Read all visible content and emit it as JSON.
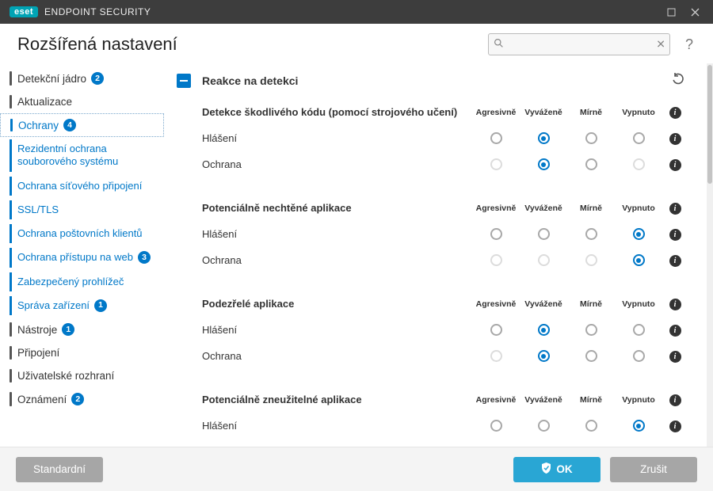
{
  "app": {
    "brand": "eset",
    "product": "ENDPOINT SECURITY",
    "page_title": "Rozšířená nastavení",
    "search_placeholder": ""
  },
  "sidebar": [
    {
      "label": "Detekční jádro",
      "level": 0,
      "badge": "2",
      "blue": false
    },
    {
      "label": "Aktualizace",
      "level": 0,
      "badge": null,
      "blue": false
    },
    {
      "label": "Ochrany",
      "level": 0,
      "badge": "4",
      "blue": true,
      "selected": true
    },
    {
      "label": "Rezidentní ochrana souborového systému",
      "level": 1
    },
    {
      "label": "Ochrana síťového připojení",
      "level": 1
    },
    {
      "label": "SSL/TLS",
      "level": 1
    },
    {
      "label": "Ochrana poštovních klientů",
      "level": 1
    },
    {
      "label": "Ochrana přístupu na web",
      "level": 1,
      "badge": "3"
    },
    {
      "label": "Zabezpečený prohlížeč",
      "level": 1
    },
    {
      "label": "Správa zařízení",
      "level": 1,
      "badge": "1"
    },
    {
      "label": "Nástroje",
      "level": 0,
      "badge": "1",
      "blue": false
    },
    {
      "label": "Připojení",
      "level": 0,
      "badge": null,
      "blue": false
    },
    {
      "label": "Uživatelské rozhraní",
      "level": 0,
      "badge": null,
      "blue": false
    },
    {
      "label": "Oznámení",
      "level": 0,
      "badge": "2",
      "blue": false
    }
  ],
  "columns": [
    "Agresivně",
    "Vyváženě",
    "Mírně",
    "Vypnuto"
  ],
  "section": {
    "title": "Reakce na detekci",
    "groups": [
      {
        "title": "Detekce škodlivého kódu (pomocí strojového učení)",
        "rows": [
          {
            "label": "Hlášení",
            "selected": 1,
            "disabled": []
          },
          {
            "label": "Ochrana",
            "selected": 1,
            "disabled": [
              0,
              3
            ]
          }
        ]
      },
      {
        "title": "Potenciálně nechtěné aplikace",
        "rows": [
          {
            "label": "Hlášení",
            "selected": 3,
            "disabled": []
          },
          {
            "label": "Ochrana",
            "selected": 3,
            "disabled": [
              0,
              1,
              2
            ]
          }
        ]
      },
      {
        "title": "Podezřelé aplikace",
        "rows": [
          {
            "label": "Hlášení",
            "selected": 1,
            "disabled": []
          },
          {
            "label": "Ochrana",
            "selected": 1,
            "disabled": [
              0
            ]
          }
        ]
      },
      {
        "title": "Potenciálně zneužitelné aplikace",
        "rows": [
          {
            "label": "Hlášení",
            "selected": 3,
            "disabled": []
          }
        ]
      }
    ]
  },
  "footer": {
    "default": "Standardní",
    "ok": "OK",
    "cancel": "Zrušit"
  }
}
